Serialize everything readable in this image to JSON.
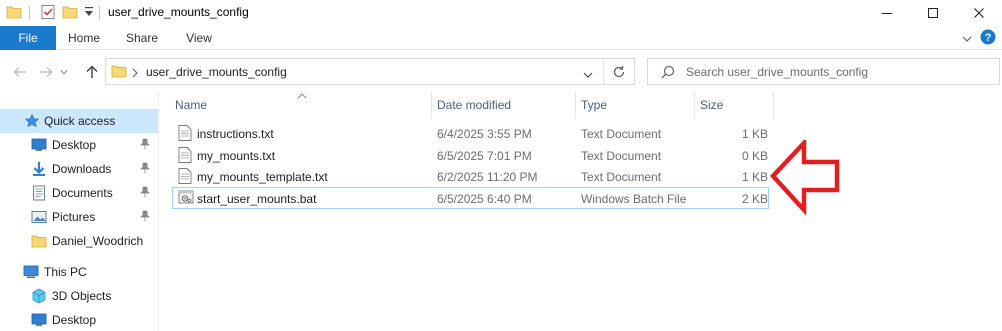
{
  "window": {
    "title": "user_drive_mounts_config",
    "controls": {
      "minimize": "minimize",
      "maximize": "maximize",
      "close": "close"
    }
  },
  "ribbon": {
    "tabs": [
      {
        "label": "File"
      },
      {
        "label": "Home"
      },
      {
        "label": "Share"
      },
      {
        "label": "View"
      }
    ]
  },
  "address": {
    "path": "user_drive_mounts_config",
    "search_placeholder": "Search user_drive_mounts_config"
  },
  "sidebar": {
    "items": [
      {
        "label": "Quick access",
        "icon": "star-icon",
        "pinned": false,
        "selected": true
      },
      {
        "label": "Desktop",
        "icon": "desktop-icon",
        "pinned": true
      },
      {
        "label": "Downloads",
        "icon": "download-icon",
        "pinned": true
      },
      {
        "label": "Documents",
        "icon": "documents-icon",
        "pinned": true
      },
      {
        "label": "Pictures",
        "icon": "pictures-icon",
        "pinned": true
      },
      {
        "label": "Daniel_Woodrich",
        "icon": "folder-icon",
        "pinned": false
      },
      {
        "label": "This PC",
        "icon": "computer-icon",
        "pinned": false
      },
      {
        "label": "3D Objects",
        "icon": "cube-icon",
        "pinned": false
      },
      {
        "label": "Desktop",
        "icon": "desktop-icon",
        "pinned": false
      }
    ]
  },
  "columns": {
    "name": "Name",
    "date": "Date modified",
    "type": "Type",
    "size": "Size"
  },
  "files": [
    {
      "name": "instructions.txt",
      "date": "6/4/2025 3:55 PM",
      "type": "Text Document",
      "size": "1 KB",
      "icon": "text-file-icon"
    },
    {
      "name": "my_mounts.txt",
      "date": "6/5/2025 7:01 PM",
      "type": "Text Document",
      "size": "0 KB",
      "icon": "text-file-icon"
    },
    {
      "name": "my_mounts_template.txt",
      "date": "6/2/2025 11:20 PM",
      "type": "Text Document",
      "size": "1 KB",
      "icon": "text-file-icon"
    },
    {
      "name": "start_user_mounts.bat",
      "date": "6/5/2025 6:40 PM",
      "type": "Windows Batch File",
      "size": "2 KB",
      "icon": "batch-file-icon",
      "highlighted": true
    }
  ],
  "colors": {
    "accent": "#1979ca",
    "selection": "#cce8ff",
    "highlight_border": "#99d1ff",
    "annotation": "#e02020",
    "folder": "#f8d775"
  }
}
